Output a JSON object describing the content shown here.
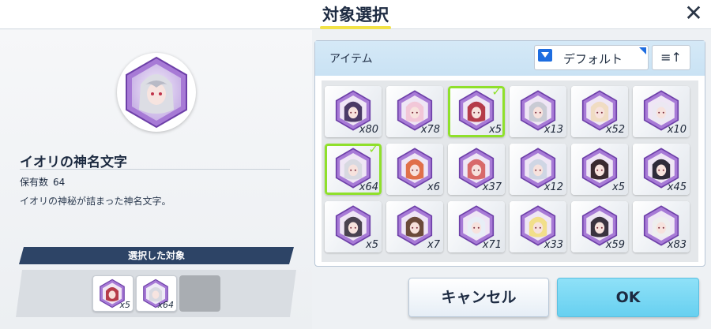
{
  "header": {
    "title": "対象選択",
    "close_icon": "close-icon",
    "close_glyph": "✕"
  },
  "detail": {
    "name": "イオリの神名文字",
    "owned_label": "保有数",
    "owned_count": "64",
    "description": "イオリの神秘が詰まった神名文字。"
  },
  "selected": {
    "header": "選択した対象",
    "slots": [
      {
        "count": "x5"
      },
      {
        "count": "x64"
      },
      {
        "count": ""
      }
    ]
  },
  "panel": {
    "label": "アイテム",
    "sort_label": "デフォルト",
    "order_glyph": "≡↑"
  },
  "items": [
    {
      "count": "x80",
      "selected": false
    },
    {
      "count": "x78",
      "selected": false
    },
    {
      "count": "x5",
      "selected": true
    },
    {
      "count": "x13",
      "selected": false
    },
    {
      "count": "x52",
      "selected": false
    },
    {
      "count": "x10",
      "selected": false
    },
    {
      "count": "x64",
      "selected": true
    },
    {
      "count": "x6",
      "selected": false
    },
    {
      "count": "x37",
      "selected": false
    },
    {
      "count": "x12",
      "selected": false
    },
    {
      "count": "x5",
      "selected": false
    },
    {
      "count": "x45",
      "selected": false
    },
    {
      "count": "x5",
      "selected": false
    },
    {
      "count": "x7",
      "selected": false
    },
    {
      "count": "x71",
      "selected": false
    },
    {
      "count": "x33",
      "selected": false
    },
    {
      "count": "x59",
      "selected": false
    },
    {
      "count": "x83",
      "selected": false
    }
  ],
  "buttons": {
    "cancel": "キャンセル",
    "ok": "OK"
  },
  "colors": {
    "accent_green": "#8fe02b",
    "ok_blue": "#67d0f0",
    "header_navy": "#2d4466",
    "frame_purple": "#a77ad6"
  }
}
